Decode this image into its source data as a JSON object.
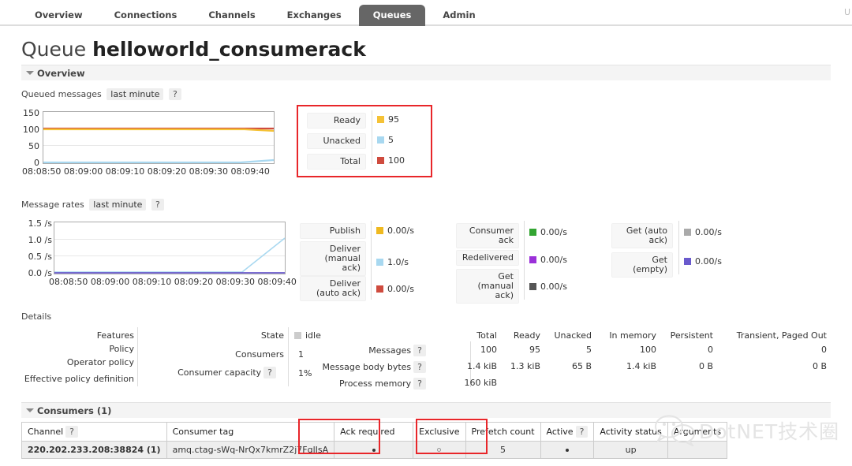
{
  "nav": {
    "tabs": [
      {
        "label": "Overview",
        "active": false
      },
      {
        "label": "Connections",
        "active": false
      },
      {
        "label": "Channels",
        "active": false
      },
      {
        "label": "Exchanges",
        "active": false
      },
      {
        "label": "Queues",
        "active": true
      },
      {
        "label": "Admin",
        "active": false
      }
    ],
    "right_text": "U"
  },
  "page": {
    "title_prefix": "Queue",
    "title_name": "helloworld_consumerack"
  },
  "overview_section": {
    "label": "Overview"
  },
  "details_section": {
    "label": "Details"
  },
  "consumers_section": {
    "label": "Consumers (1)"
  },
  "queued_messages": {
    "title": "Queued messages",
    "period": "last minute",
    "help": "?",
    "legend": [
      {
        "label": "Ready",
        "value": "95",
        "color": "#f5c236"
      },
      {
        "label": "Unacked",
        "value": "5",
        "color": "#a8d8f0"
      },
      {
        "label": "Total",
        "value": "100",
        "color": "#cf4b3e"
      }
    ]
  },
  "message_rates": {
    "title": "Message rates",
    "period": "last minute",
    "help": "?",
    "col1": [
      {
        "label": "Publish",
        "value": "0.00/s",
        "color": "#efb920"
      },
      {
        "label": "Deliver (manual ack)",
        "value": "1.0/s",
        "color": "#a8d8f0"
      },
      {
        "label": "Deliver (auto ack)",
        "value": "0.00/s",
        "color": "#cf4b3e"
      }
    ],
    "col2": [
      {
        "label": "Consumer ack",
        "value": "0.00/s",
        "color": "#33a532"
      },
      {
        "label": "Redelivered",
        "value": "0.00/s",
        "color": "#9b30d9"
      },
      {
        "label": "Get (manual ack)",
        "value": "0.00/s",
        "color": "#555555"
      }
    ],
    "col3": [
      {
        "label": "Get (auto ack)",
        "value": "0.00/s",
        "color": "#aaaaaa"
      },
      {
        "label": "Get (empty)",
        "value": "0.00/s",
        "color": "#6a5acd"
      }
    ]
  },
  "chart_data": [
    {
      "type": "line",
      "title": "Queued messages",
      "subtitle": "last minute",
      "xlabel": "",
      "ylabel": "",
      "ylim": [
        0,
        150
      ],
      "yticks": [
        "0",
        "50",
        "100",
        "150"
      ],
      "x": [
        "08:08:50",
        "08:09:00",
        "08:09:10",
        "08:09:20",
        "08:09:30",
        "08:09:40"
      ],
      "grid": true,
      "legend_position": "right",
      "series": [
        {
          "name": "Total",
          "color": "#cf4b3e",
          "values": [
            100,
            100,
            100,
            100,
            100,
            100
          ]
        },
        {
          "name": "Ready",
          "color": "#f5c236",
          "values": [
            100,
            100,
            100,
            100,
            100,
            95
          ]
        },
        {
          "name": "Unacked",
          "color": "#a8d8f0",
          "values": [
            0,
            0,
            0,
            0,
            0,
            5
          ]
        }
      ]
    },
    {
      "type": "line",
      "title": "Message rates",
      "subtitle": "last minute",
      "xlabel": "",
      "ylabel": "/s",
      "ylim": [
        0.0,
        1.5
      ],
      "yticks": [
        "0.0 /s",
        "0.5 /s",
        "1.0 /s",
        "1.5 /s"
      ],
      "x": [
        "08:08:50",
        "08:09:00",
        "08:09:10",
        "08:09:20",
        "08:09:30",
        "08:09:40"
      ],
      "grid": true,
      "legend_position": "right",
      "series": [
        {
          "name": "Deliver (manual ack)",
          "color": "#a8d8f0",
          "values": [
            0.0,
            0.0,
            0.0,
            0.0,
            0.0,
            1.0
          ]
        },
        {
          "name": "Publish",
          "color": "#efb920",
          "values": [
            0.0,
            0.0,
            0.0,
            0.0,
            0.0,
            0.0
          ]
        },
        {
          "name": "Deliver (auto ack)",
          "color": "#cf4b3e",
          "values": [
            0.0,
            0.0,
            0.0,
            0.0,
            0.0,
            0.0
          ]
        },
        {
          "name": "Get (empty)",
          "color": "#6a5acd",
          "values": [
            0.0,
            0.0,
            0.0,
            0.0,
            0.0,
            0.0
          ]
        }
      ]
    }
  ],
  "details": {
    "left_labels": [
      "Features",
      "Policy",
      "Operator policy",
      "Effective policy definition"
    ],
    "mid": [
      {
        "label": "State",
        "value": "idle",
        "has_swatch": true
      },
      {
        "label": "Consumers",
        "value": "1",
        "has_swatch": false
      },
      {
        "label": "Consumer capacity",
        "value": "1%",
        "has_swatch": false,
        "help": "?"
      }
    ],
    "msg_headers": [
      "Total",
      "Ready",
      "Unacked",
      "In memory",
      "Persistent",
      "Transient, Paged Out"
    ],
    "msg_rows": [
      {
        "label": "Messages",
        "help": "?",
        "values": [
          "100",
          "95",
          "5",
          "100",
          "0",
          "0"
        ]
      },
      {
        "label": "Message body bytes",
        "help": "?",
        "values": [
          "1.4 kiB",
          "1.3 kiB",
          "65 B",
          "1.4 kiB",
          "0 B",
          "0 B"
        ]
      },
      {
        "label": "Process memory",
        "help": "?",
        "values": [
          "160 kiB",
          "",
          "",
          "",
          "",
          ""
        ]
      }
    ]
  },
  "consumers_table": {
    "headers": [
      "Channel",
      "Consumer tag",
      "Ack required",
      "Exclusive",
      "Prefetch count",
      "Active",
      "Activity status",
      "Arguments"
    ],
    "channel_help": "?",
    "active_help": "?",
    "rows": [
      {
        "channel": "220.202.233.208:38824 (1)",
        "consumer_tag": "amq.ctag-sWq-NrQx7kmrZ2j7FglIsA",
        "ack_required": "●",
        "exclusive": "○",
        "prefetch_count": "5",
        "active": "●",
        "activity_status": "up",
        "arguments": ""
      }
    ]
  },
  "watermark": {
    "text": "DotNET技术圈"
  },
  "annotations": {
    "accent_color": "#e8262a",
    "boxes": [
      "queued-messages-legend",
      "ack-required-column",
      "prefetch-count-column"
    ]
  }
}
